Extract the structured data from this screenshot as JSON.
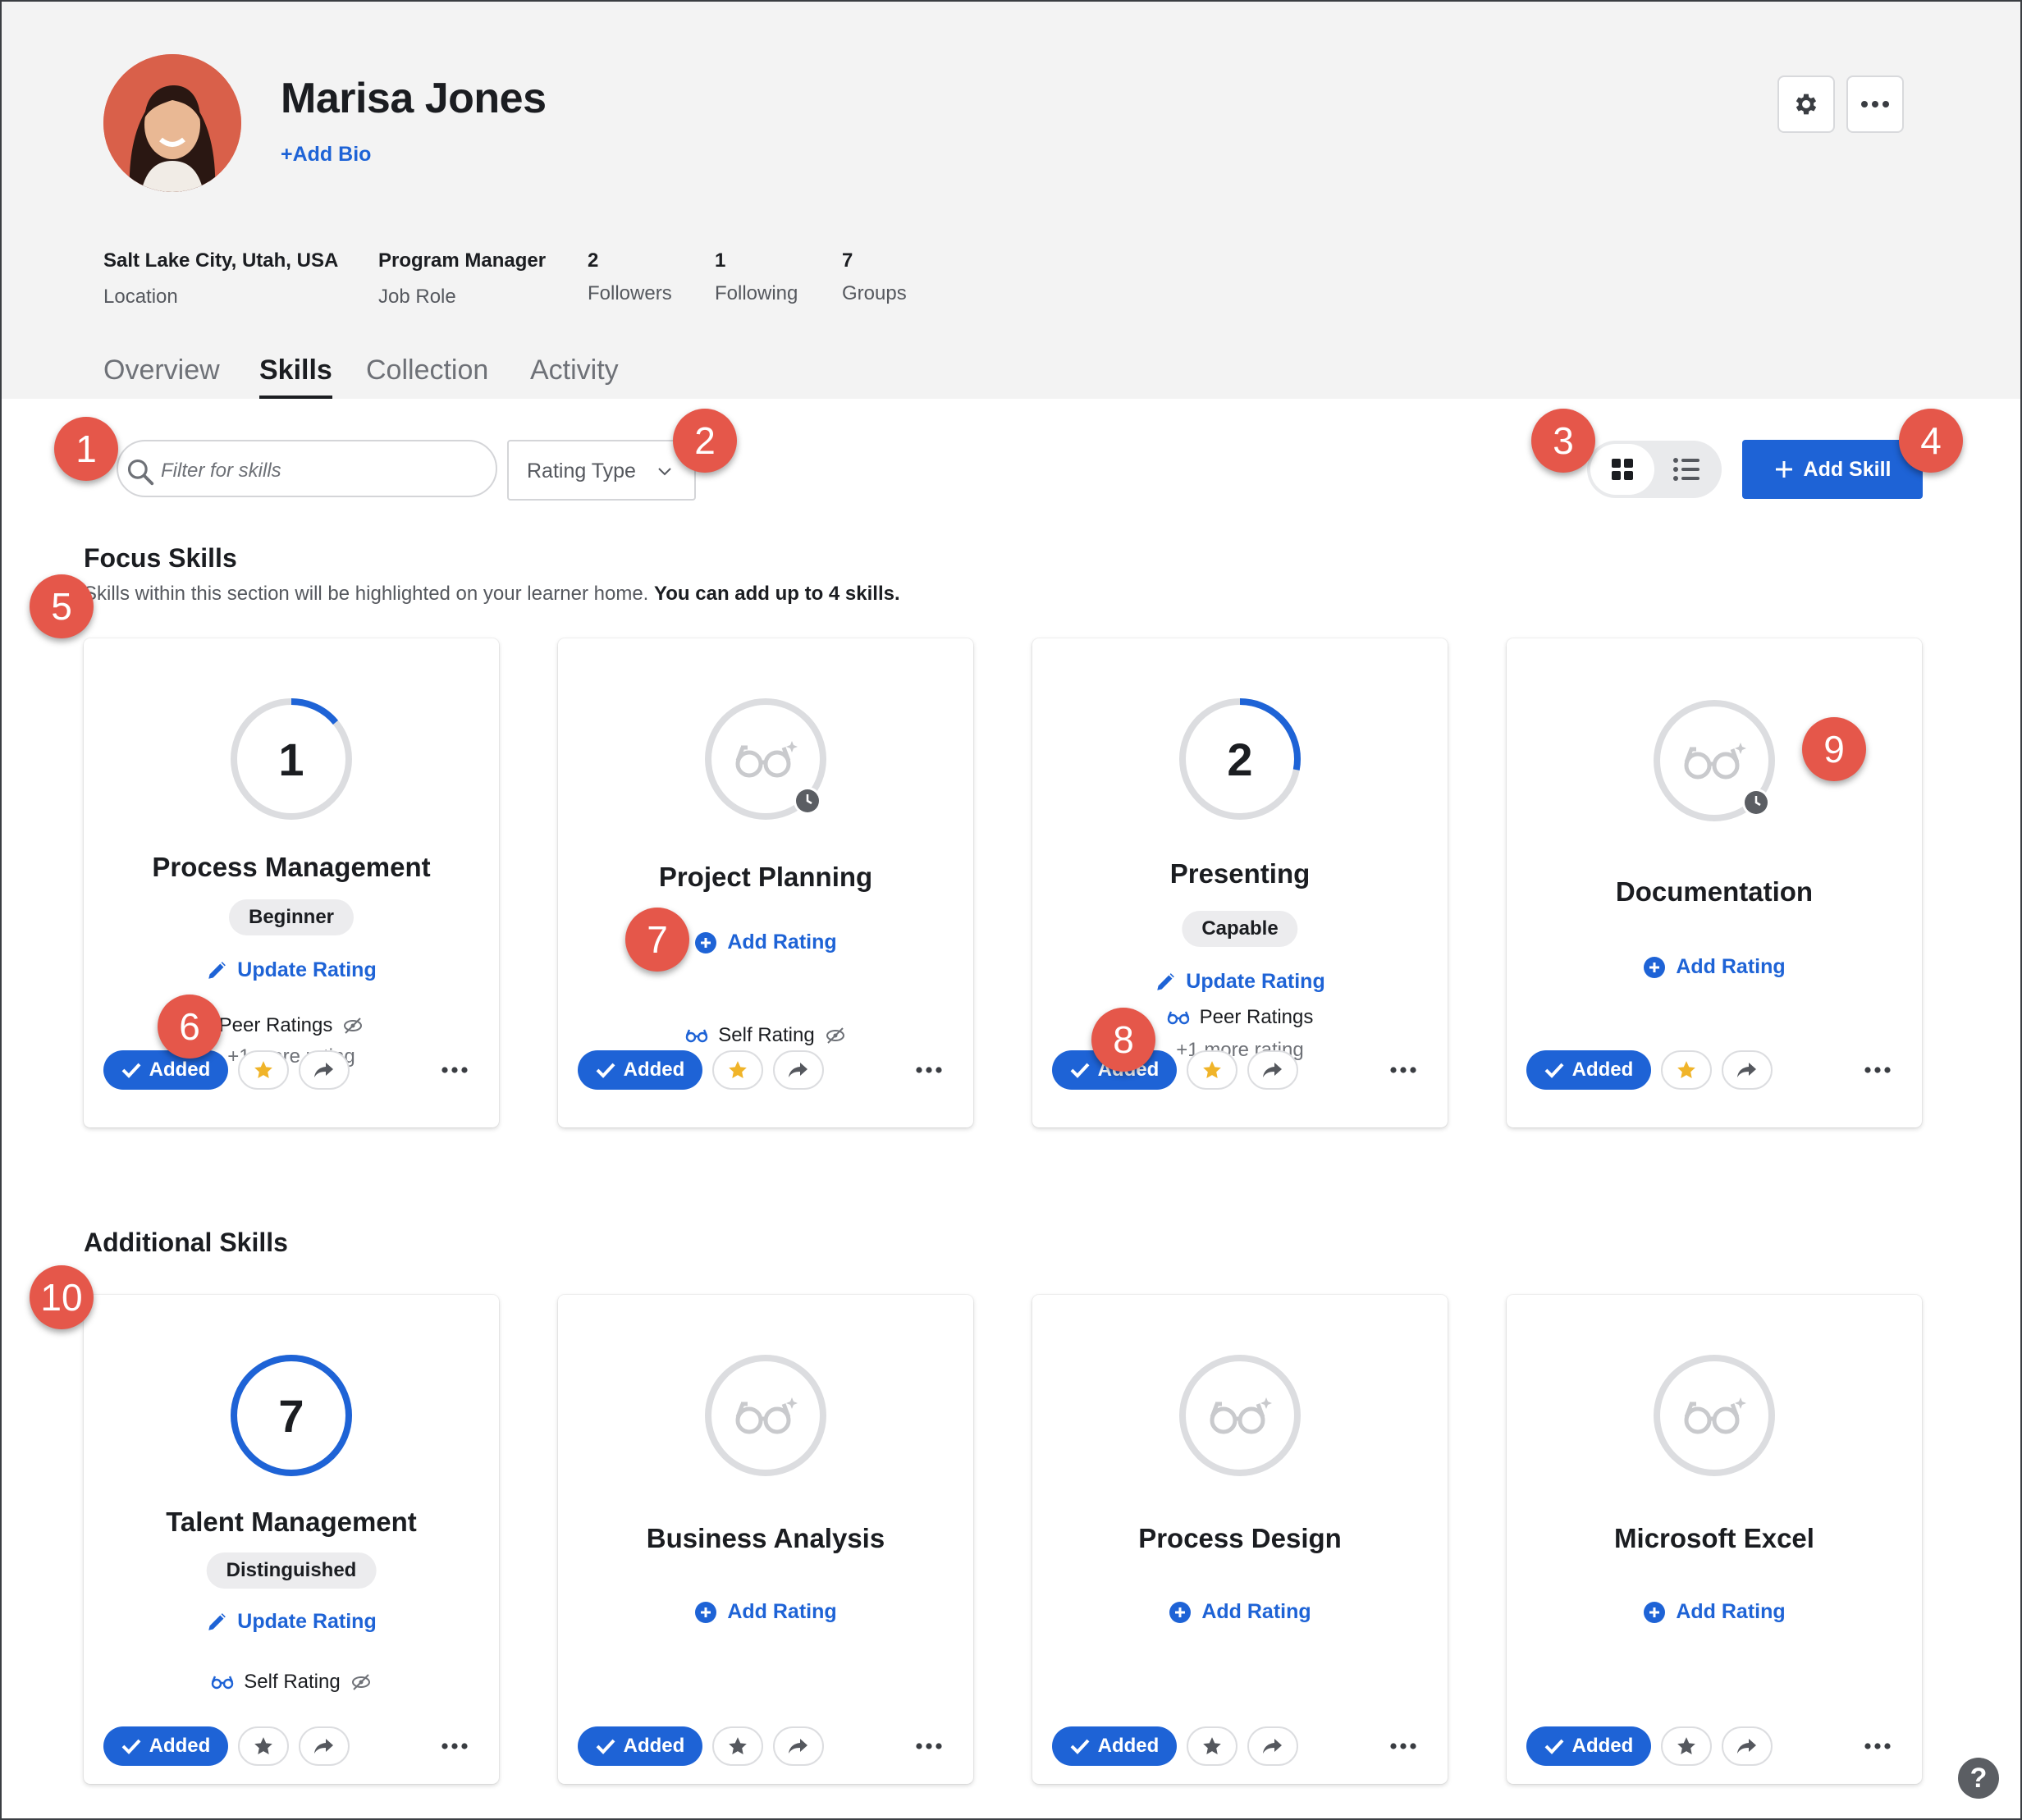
{
  "profile": {
    "name": "Marisa Jones",
    "add_bio": "+Add Bio",
    "meta": [
      {
        "value": "Salt Lake City, Utah, USA",
        "label": "Location"
      },
      {
        "value": "Program Manager",
        "label": "Job Role"
      },
      {
        "value": "2",
        "label": "Followers"
      },
      {
        "value": "1",
        "label": "Following"
      },
      {
        "value": "7",
        "label": "Groups"
      }
    ]
  },
  "tabs": [
    {
      "label": "Overview",
      "active": false
    },
    {
      "label": "Skills",
      "active": true
    },
    {
      "label": "Collection",
      "active": false
    },
    {
      "label": "Activity",
      "active": false
    }
  ],
  "toolbar": {
    "search_placeholder": "Filter for skills",
    "rating_type": "Rating Type",
    "add_skill": "Add Skill"
  },
  "focus": {
    "title": "Focus Skills",
    "desc": "Skills within this section will be highlighted on your learner home.",
    "desc_bold": "You can add up to 4 skills."
  },
  "additional": {
    "title": "Additional Skills"
  },
  "common": {
    "added": "Added",
    "update_rating": "Update Rating",
    "add_rating": "Add Rating"
  },
  "cards": [
    {
      "title": "Process Management",
      "level_number": "1",
      "ring_fraction": 0.14,
      "badge": "Beginner",
      "rating_label": "Peer Ratings",
      "more": "+1 more rating",
      "starred": true
    },
    {
      "title": "Project Planning",
      "rating_label": "Self Rating",
      "pending": true,
      "starred": true
    },
    {
      "title": "Presenting",
      "level_number": "2",
      "ring_fraction": 0.28,
      "badge": "Capable",
      "rating_label": "Peer Ratings",
      "more": "+1 more rating",
      "starred": true
    },
    {
      "title": "Documentation",
      "pending": true,
      "starred": true
    },
    {
      "title": "Talent Management",
      "level_number": "7",
      "ring_fraction": 1.0,
      "badge": "Distinguished",
      "rating_label": "Self Rating",
      "starred": false
    },
    {
      "title": "Business Analysis",
      "starred": false
    },
    {
      "title": "Process Design",
      "starred": false
    },
    {
      "title": "Microsoft Excel",
      "starred": false
    }
  ],
  "callouts": [
    "1",
    "2",
    "3",
    "4",
    "5",
    "6",
    "7",
    "8",
    "9",
    "10"
  ],
  "help": "?",
  "colors": {
    "accent": "#1e63d6",
    "callout": "#e5574a",
    "star": "#f0b429"
  }
}
